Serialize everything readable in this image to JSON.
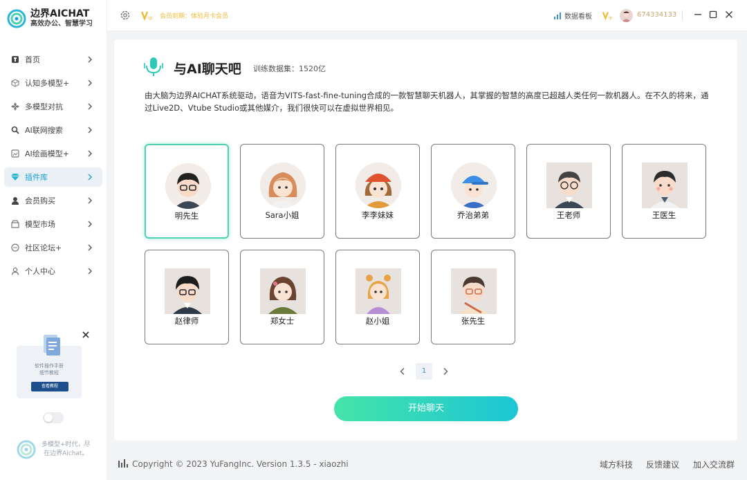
{
  "app": {
    "name": "边界AICHAT",
    "tagline": "高效办公、智慧学习"
  },
  "topbar": {
    "member_notice": "会员到期：体验月卡会员",
    "data_board": "数据看板",
    "user_id": "674334133"
  },
  "sidebar": {
    "items": [
      {
        "label": "首页",
        "icon": "home-icon"
      },
      {
        "label": "认知多模型+",
        "icon": "cube-icon"
      },
      {
        "label": "多模型对抗",
        "icon": "grid-icon"
      },
      {
        "label": "AI联网搜索",
        "icon": "search-icon"
      },
      {
        "label": "AI绘画模型+",
        "icon": "image-icon"
      },
      {
        "label": "插件库",
        "icon": "diamond-icon",
        "active": true
      },
      {
        "label": "会员购买",
        "icon": "user-icon"
      },
      {
        "label": "模型市场",
        "icon": "shop-icon"
      },
      {
        "label": "社区论坛+",
        "icon": "chat-icon"
      },
      {
        "label": "个人中心",
        "icon": "person-icon"
      }
    ],
    "promo": {
      "line1": "软件操作手册",
      "line2": "细节教程",
      "button": "查看教程"
    },
    "footer_line1": "多模型+时代，尽",
    "footer_line2": "在边界Aichat。"
  },
  "main": {
    "title": "与AI聊天吧",
    "dataset": "训练数据集：1520亿",
    "description": "由大脑为边界AICHAT系统驱动，语音为VITS-fast-fine-tuning合成的一款智慧聊天机器人，其掌握的智慧的高度已超越人类任何一款机器人。在不久的将来，通过Live2D、Vtube Studio或其他媒介，我们很快可以在虚拟世界相见。",
    "characters": [
      {
        "name": "明先生",
        "selected": true
      },
      {
        "name": "Sara小姐"
      },
      {
        "name": "李李妹妹"
      },
      {
        "name": "乔治弟弟"
      },
      {
        "name": "王老师"
      },
      {
        "name": "王医生"
      },
      {
        "name": "赵律师"
      },
      {
        "name": "郑女士"
      },
      {
        "name": "赵小姐"
      },
      {
        "name": "张先生"
      }
    ],
    "page": "1",
    "start_button": "开始聊天"
  },
  "footer": {
    "copyright": "Copyright © 2023 YuFangInc. Version 1.3.5 - xiaozhi",
    "links": [
      "域方科技",
      "反馈建议",
      "加入交流群"
    ]
  },
  "colors": {
    "accent": "#1a9fd6",
    "green": "#4fd1b3",
    "gold": "#f0b93a"
  }
}
